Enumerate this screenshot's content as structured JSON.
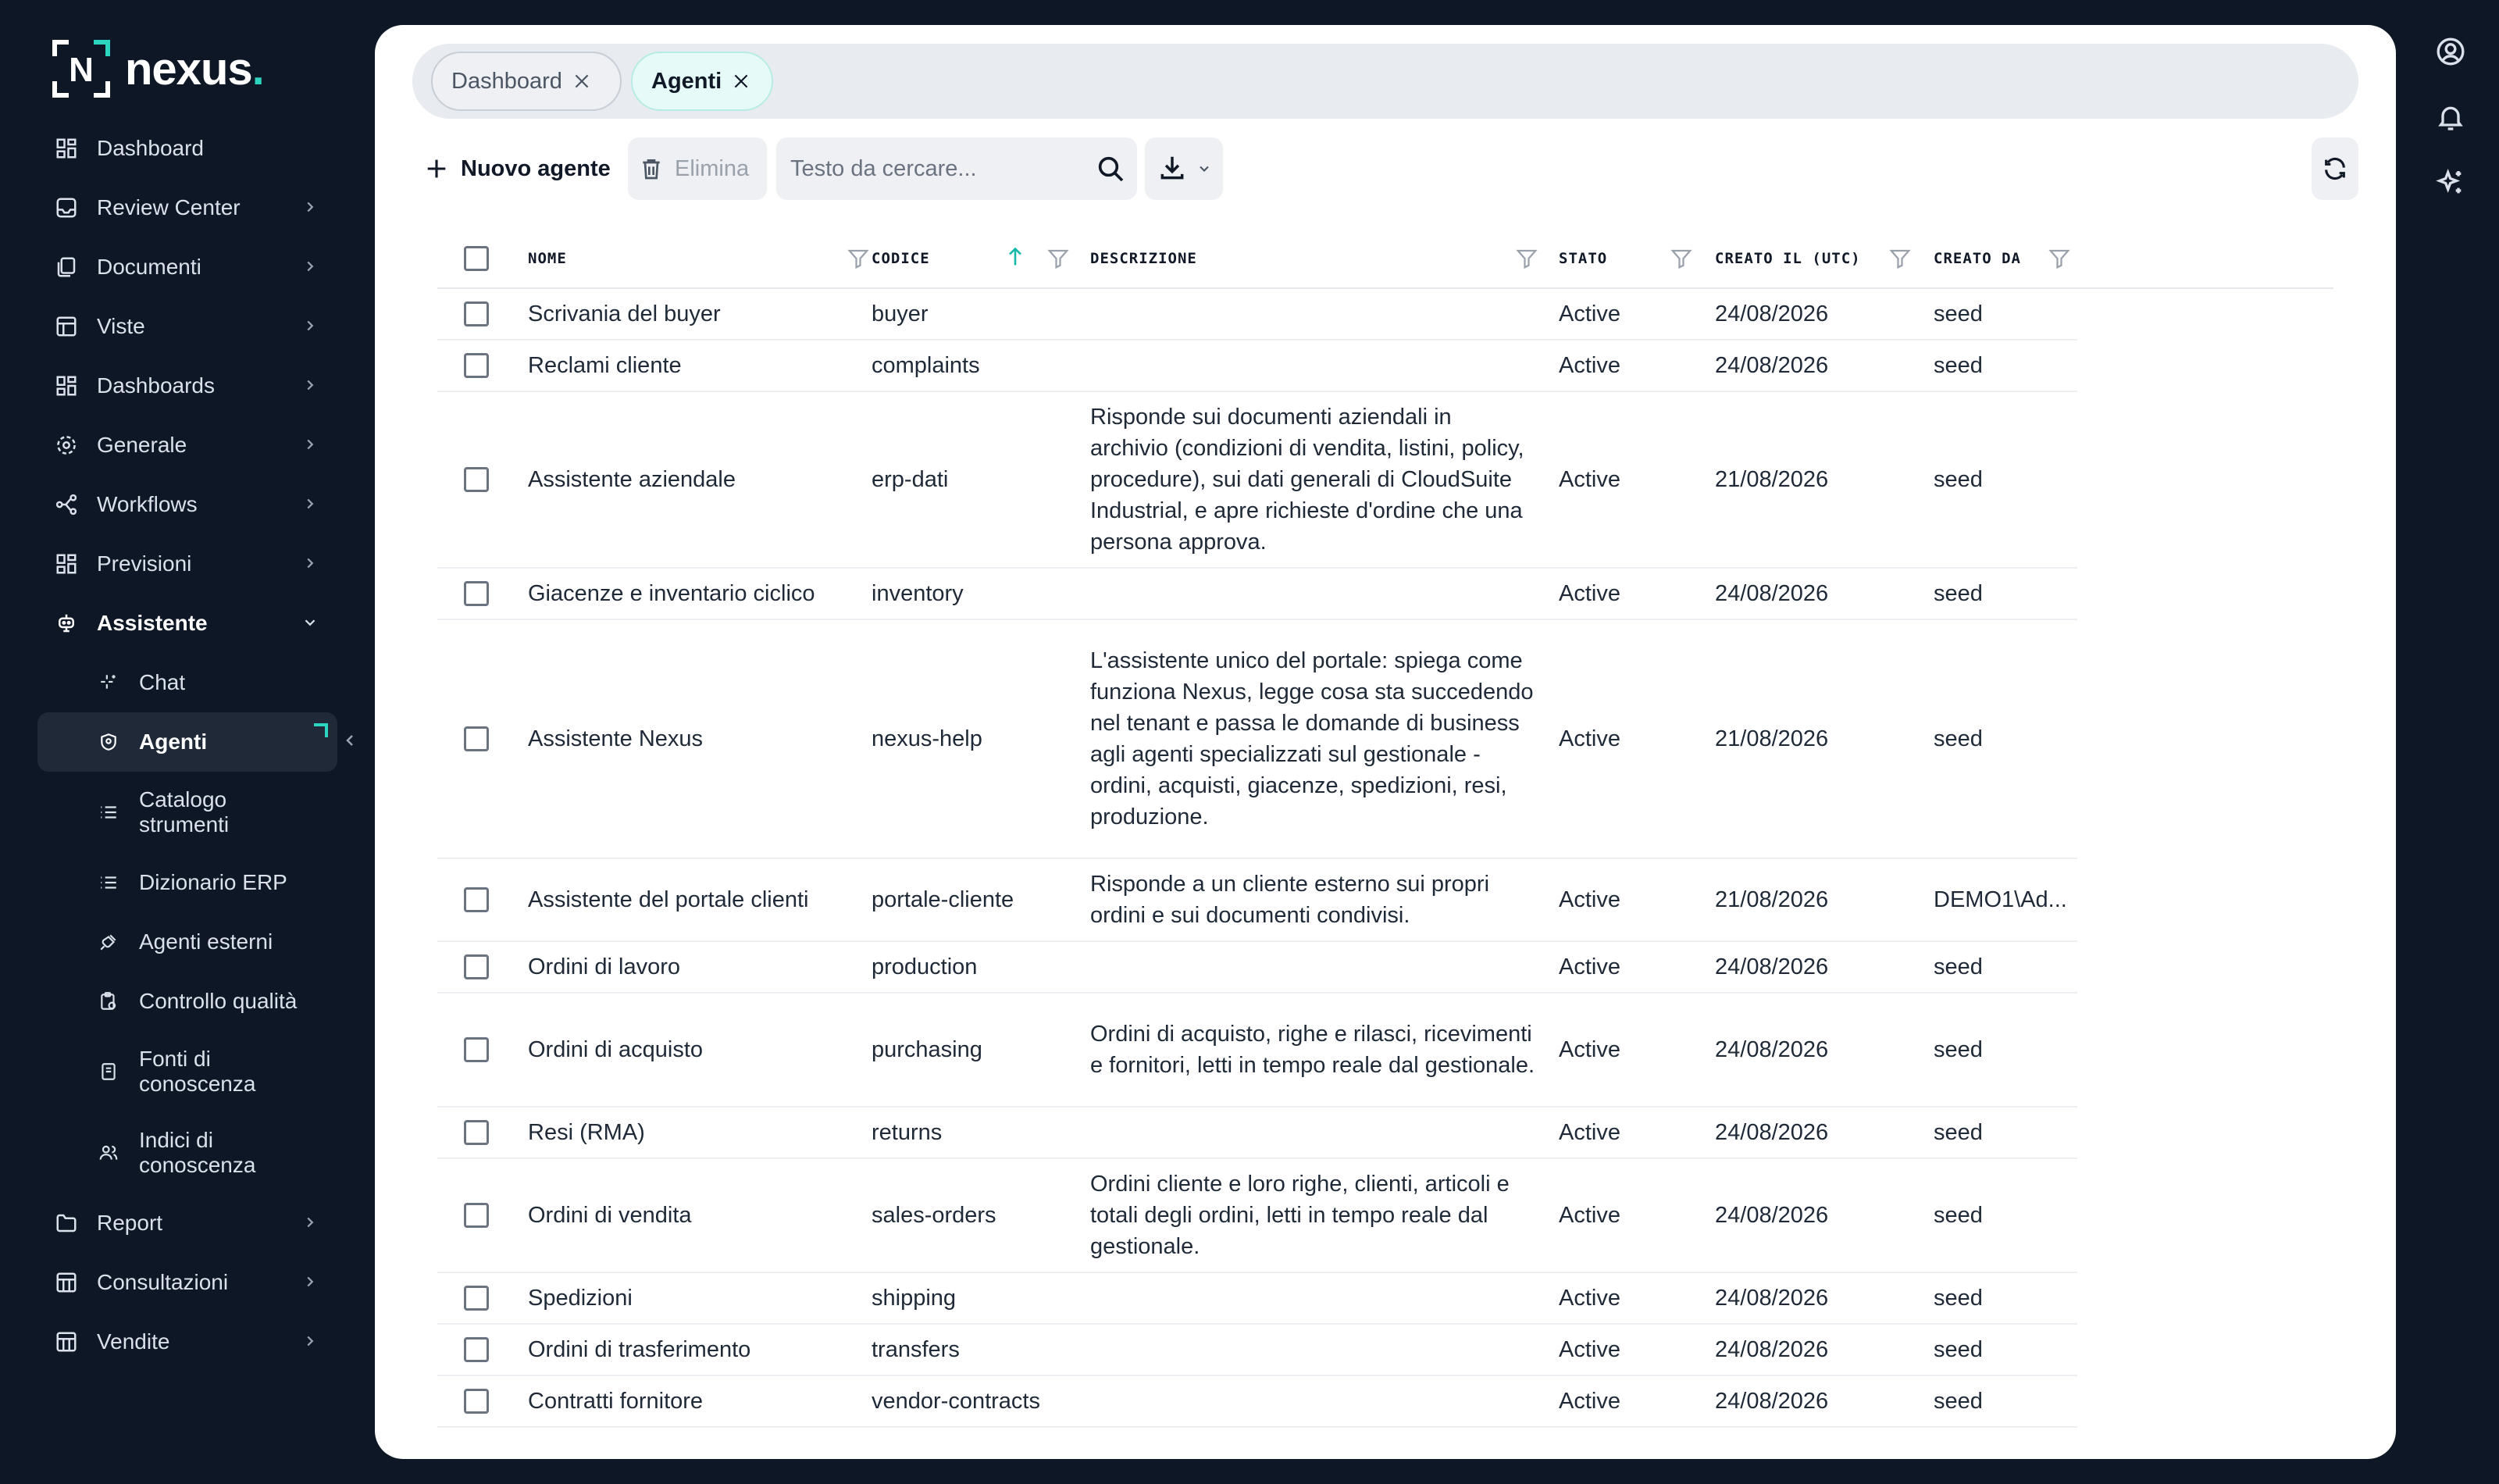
{
  "brand": {
    "name": "nexus",
    "dot": ".",
    "mark": "N"
  },
  "sidebar": {
    "items": [
      {
        "label": "Dashboard",
        "icon": "grid-icon"
      },
      {
        "label": "Review Center",
        "icon": "inbox-icon"
      },
      {
        "label": "Documenti",
        "icon": "documents-icon"
      },
      {
        "label": "Viste",
        "icon": "table-icon"
      },
      {
        "label": "Dashboards",
        "icon": "grid-icon"
      },
      {
        "label": "Generale",
        "icon": "gear-icon"
      },
      {
        "label": "Workflows",
        "icon": "workflow-icon"
      },
      {
        "label": "Previsioni",
        "icon": "grid-icon"
      },
      {
        "label": "Assistente",
        "icon": "robot-icon"
      },
      {
        "label": "Chat",
        "icon": "sparkle-icon"
      },
      {
        "label": "Agenti",
        "icon": "shield-icon"
      },
      {
        "label": "Catalogo strumenti",
        "icon": "list-icon"
      },
      {
        "label": "Dizionario ERP",
        "icon": "list-icon"
      },
      {
        "label": "Agenti esterni",
        "icon": "plug-icon"
      },
      {
        "label": "Controllo qualità",
        "icon": "clipboard-icon"
      },
      {
        "label": "Fonti di conoscenza",
        "icon": "book-icon"
      },
      {
        "label": "Indici di conoscenza",
        "icon": "users-icon"
      },
      {
        "label": "Report",
        "icon": "folder-icon"
      },
      {
        "label": "Consultazioni",
        "icon": "table-icon"
      },
      {
        "label": "Vendite",
        "icon": "table-icon"
      }
    ],
    "sub_top": {
      "catalogo_1": "Catalogo",
      "catalogo_2": "strumenti",
      "fonti_1": "Fonti di",
      "fonti_2": "conoscenza",
      "indici_1": "Indici di",
      "indici_2": "conoscenza"
    }
  },
  "tabs": [
    {
      "label": "Dashboard"
    },
    {
      "label": "Agenti"
    }
  ],
  "toolbar": {
    "new_label": "Nuovo agente",
    "delete_label": "Elimina",
    "search_placeholder": "Testo da cercare..."
  },
  "table": {
    "columns": [
      "NOME",
      "CODICE",
      "DESCRIZIONE",
      "STATO",
      "CREATO IL (UTC)",
      "CREATO DA"
    ],
    "rows": [
      {
        "nome": "Scrivania del buyer",
        "codice": "buyer",
        "descrizione": "",
        "stato": "Active",
        "creato_il": "24/08/2026",
        "creato_da": "seed"
      },
      {
        "nome": "Reclami cliente",
        "codice": "complaints",
        "descrizione": "",
        "stato": "Active",
        "creato_il": "24/08/2026",
        "creato_da": "seed"
      },
      {
        "nome": "Assistente aziendale",
        "codice": "erp-dati",
        "descrizione": "Risponde sui documenti aziendali in archivio (condizioni di vendita, listini, policy, procedure), sui dati generali di CloudSuite Industrial, e apre richieste d'ordine che una persona approva.",
        "stato": "Active",
        "creato_il": "21/08/2026",
        "creato_da": "seed"
      },
      {
        "nome": "Giacenze e inventario ciclico",
        "codice": "inventory",
        "descrizione": "",
        "stato": "Active",
        "creato_il": "24/08/2026",
        "creato_da": "seed"
      },
      {
        "nome": "Assistente Nexus",
        "codice": "nexus-help",
        "descrizione": "L'assistente unico del portale: spiega come funziona Nexus, legge cosa sta succedendo nel tenant e passa le domande di business agli agenti specializzati sul gestionale - ordini, acquisti, giacenze, spedizioni, resi, produzione.",
        "stato": "Active",
        "creato_il": "21/08/2026",
        "creato_da": "seed"
      },
      {
        "nome": "Assistente del portale clienti",
        "codice": "portale-cliente",
        "descrizione": "Risponde a un cliente esterno sui propri ordini e sui documenti condivisi.",
        "stato": "Active",
        "creato_il": "21/08/2026",
        "creato_da": "DEMO1\\Ad..."
      },
      {
        "nome": "Ordini di lavoro",
        "codice": "production",
        "descrizione": "",
        "stato": "Active",
        "creato_il": "24/08/2026",
        "creato_da": "seed"
      },
      {
        "nome": "Ordini di acquisto",
        "codice": "purchasing",
        "descrizione": "Ordini di acquisto, righe e rilasci, ricevimenti e fornitori, letti in tempo reale dal gestionale.",
        "stato": "Active",
        "creato_il": "24/08/2026",
        "creato_da": "seed"
      },
      {
        "nome": "Resi (RMA)",
        "codice": "returns",
        "descrizione": "",
        "stato": "Active",
        "creato_il": "24/08/2026",
        "creato_da": "seed"
      },
      {
        "nome": "Ordini di vendita",
        "codice": "sales-orders",
        "descrizione": "Ordini cliente e loro righe, clienti, articoli e totali degli ordini, letti in tempo reale dal gestionale.",
        "stato": "Active",
        "creato_il": "24/08/2026",
        "creato_da": "seed"
      },
      {
        "nome": "Spedizioni",
        "codice": "shipping",
        "descrizione": "",
        "stato": "Active",
        "creato_il": "24/08/2026",
        "creato_da": "seed"
      },
      {
        "nome": "Ordini di trasferimento",
        "codice": "transfers",
        "descrizione": "",
        "stato": "Active",
        "creato_il": "24/08/2026",
        "creato_da": "seed"
      },
      {
        "nome": "Contratti fornitore",
        "codice": "vendor-contracts",
        "descrizione": "",
        "stato": "Active",
        "creato_il": "24/08/2026",
        "creato_da": "seed"
      }
    ]
  },
  "colors": {
    "accent": "#2dd4bf",
    "background": "#0e1726",
    "sort_arrow": "#14b8a6"
  }
}
